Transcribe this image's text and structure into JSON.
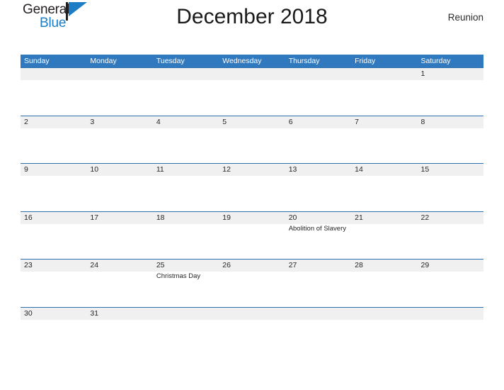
{
  "header": {
    "logo": {
      "text_primary": "General",
      "text_secondary": "Blue",
      "mark_icon": "sail-triangle-icon",
      "primary_color": "#231f20",
      "secondary_color": "#1d7dc4"
    },
    "title": "December 2018",
    "locale": "Reunion"
  },
  "calendar": {
    "header_color": "#3179bf",
    "band_color": "#f0f0f0",
    "rule_color": "#2e6fae",
    "weekdays": [
      "Sunday",
      "Monday",
      "Tuesday",
      "Wednesday",
      "Thursday",
      "Friday",
      "Saturday"
    ],
    "weeks": [
      [
        {
          "day": ""
        },
        {
          "day": ""
        },
        {
          "day": ""
        },
        {
          "day": ""
        },
        {
          "day": ""
        },
        {
          "day": ""
        },
        {
          "day": "1"
        }
      ],
      [
        {
          "day": "2"
        },
        {
          "day": "3"
        },
        {
          "day": "4"
        },
        {
          "day": "5"
        },
        {
          "day": "6"
        },
        {
          "day": "7"
        },
        {
          "day": "8"
        }
      ],
      [
        {
          "day": "9"
        },
        {
          "day": "10"
        },
        {
          "day": "11"
        },
        {
          "day": "12"
        },
        {
          "day": "13"
        },
        {
          "day": "14"
        },
        {
          "day": "15"
        }
      ],
      [
        {
          "day": "16"
        },
        {
          "day": "17"
        },
        {
          "day": "18"
        },
        {
          "day": "19"
        },
        {
          "day": "20",
          "event": "Abolition of Slavery"
        },
        {
          "day": "21"
        },
        {
          "day": "22"
        }
      ],
      [
        {
          "day": "23"
        },
        {
          "day": "24"
        },
        {
          "day": "25",
          "event": "Christmas Day"
        },
        {
          "day": "26"
        },
        {
          "day": "27"
        },
        {
          "day": "28"
        },
        {
          "day": "29"
        }
      ],
      [
        {
          "day": "30"
        },
        {
          "day": "31"
        },
        {
          "day": ""
        },
        {
          "day": ""
        },
        {
          "day": ""
        },
        {
          "day": ""
        },
        {
          "day": ""
        }
      ]
    ]
  }
}
